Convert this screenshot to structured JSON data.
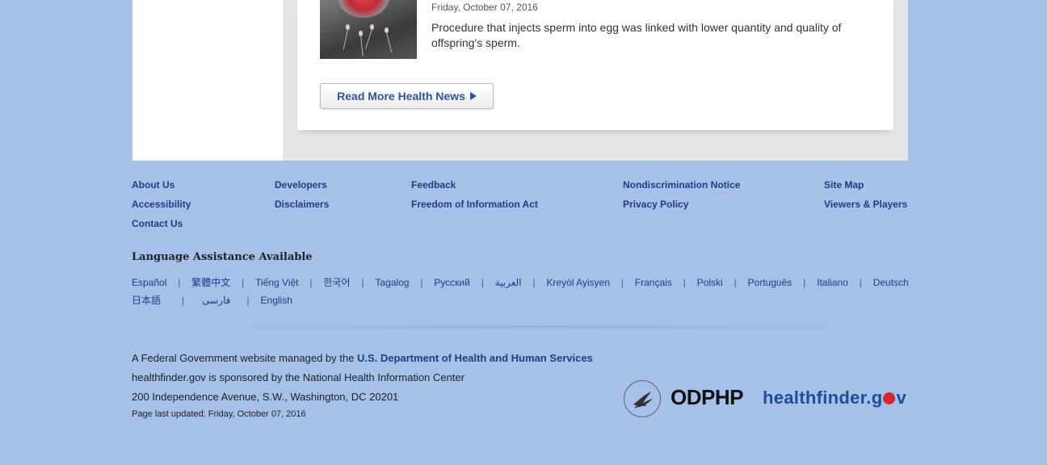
{
  "news": {
    "date": "Friday, October 07, 2016",
    "text": "Procedure that injects sperm into egg was linked with lower quantity and quality of offspring's sperm.",
    "read_more_label": "Read More Health News",
    "image_icon": "sperm-egg-photo"
  },
  "footer_links": {
    "col1": [
      "About Us",
      "Accessibility",
      "Contact Us"
    ],
    "col2": [
      "Developers",
      "Disclaimers"
    ],
    "col3": [
      "Feedback",
      "Freedom of Information Act"
    ],
    "col4": [
      "Nondiscrimination Notice",
      "Privacy Policy"
    ],
    "col5": [
      "Site Map",
      "Viewers & Players"
    ]
  },
  "language": {
    "title": "Language Assistance Available",
    "row1": [
      "Español",
      "繁體中文",
      "Tiếng Việt",
      "한국어",
      "Tagalog",
      "Русский",
      "العربية",
      "Kreyòl Ayisyen",
      "Français",
      "Polski",
      "Português",
      "Italiano",
      "Deutsch"
    ],
    "row2": [
      "日本語",
      "فارسی",
      "English"
    ],
    "separator": "|"
  },
  "footer": {
    "managed_prefix": "A Federal Government website managed by the ",
    "managed_link": "U.S. Department of Health and Human Services",
    "sponsor": "healthfinder.gov is sponsored by the National Health Information Center",
    "address": "200 Independence Avenue, S.W., Washington, DC 20201",
    "updated": "Page last updated: Friday, October 07, 2016"
  },
  "logos": {
    "odphp": "ODPHP",
    "healthfinder_prefix": "healthfinder.g",
    "healthfinder_suffix": "v",
    "hhs_icon": "hhs-eagle-seal-icon"
  },
  "colors": {
    "page_bg": "#a6c1e8",
    "link": "#1a3f85",
    "button_text": "#2d55a5",
    "healthfinder_blue": "#1f4d9a",
    "apple_red": "#d8262c"
  }
}
